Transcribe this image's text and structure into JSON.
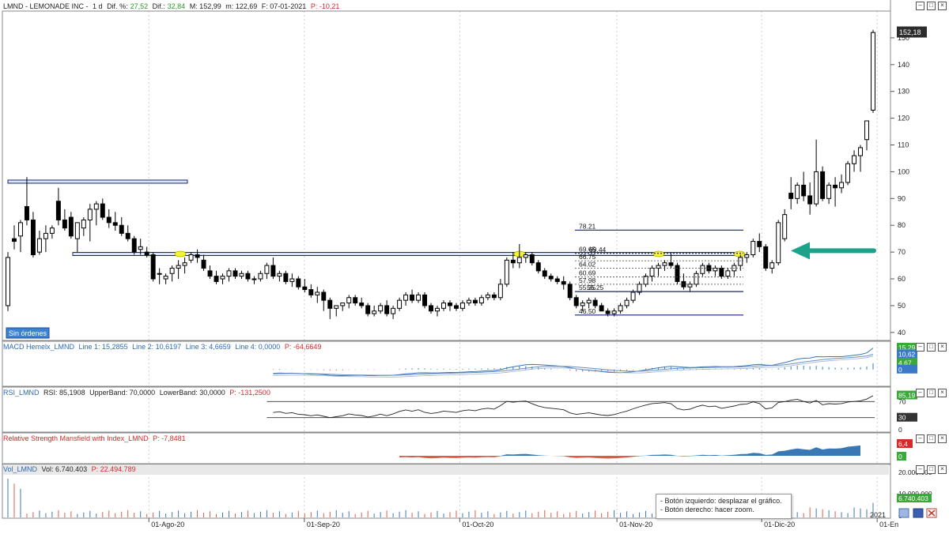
{
  "main_header": {
    "symbol": "LMND - LEMONADE INC -",
    "period": "1 d",
    "dif_pct_label": "Dif. %:",
    "dif_pct_value": "27,52",
    "dif_label": "Dif.:",
    "dif_value": "32,84",
    "max": "M: 152,99",
    "min": "m: 122,69",
    "date": "F: 07-01-2021",
    "p_value": "P: -10,21"
  },
  "sin_ordenes": "Sin órdenes",
  "price_tag": "152,18",
  "price_axis_ticks": [
    "150",
    "140",
    "130",
    "120",
    "110",
    "100",
    "90",
    "80",
    "70",
    "60",
    "50",
    "40"
  ],
  "fib_levels": [
    {
      "label": "78.21",
      "price": 78.21
    },
    {
      "label": "69.65",
      "price": 69.65
    },
    {
      "label": "69.44",
      "price": 69.44
    },
    {
      "label": "66.75",
      "price": 66.75
    },
    {
      "label": "64.02",
      "price": 64.02
    },
    {
      "label": "60.69",
      "price": 60.69
    },
    {
      "label": "57.98",
      "price": 57.98
    },
    {
      "label": "55.25",
      "price": 55.25
    },
    {
      "label": "55.35",
      "price": 55.35
    },
    {
      "label": "46.50",
      "price": 46.5
    }
  ],
  "date_labels": [
    "01-Ago-20",
    "01-Sep-20",
    "01-Oct-20",
    "01-Nov-20",
    "01-Dic-20",
    "01-En"
  ],
  "year_label": "2021",
  "macd": {
    "name": "MACD Hemelx_LMND",
    "l1": "Line 1: 15,2855",
    "l2": "Line 2: 10,6197",
    "l3": "Line 3: 4,6659",
    "l4": "Line 4: 0,0000",
    "p": "P: -64,6649",
    "tags": [
      "15,29",
      "10,62",
      "4,67",
      "0"
    ]
  },
  "rsi": {
    "name": "RSI_LMND",
    "value": "RSI: 85,1908",
    "upper": "UpperBand: 70,0000",
    "lower": "LowerBand: 30,0000",
    "p": "P: -131,2500",
    "tags": [
      "85,19",
      "70",
      "30",
      "0"
    ]
  },
  "rsm": {
    "name": "Relative Strength Mansfield with Index_LMND",
    "p": "P: -7,8481",
    "tags": [
      "6,4",
      "0"
    ]
  },
  "vol": {
    "name": "Vol_LMND",
    "value": "Vol: 6.740.403",
    "p": "P: 22.494.789",
    "tags": [
      "20.000.000",
      "10.000.000",
      "6.740.403",
      "0"
    ]
  },
  "tooltip": {
    "line1": "- Botón izquierdo: desplazar el gráfico.",
    "line2": "- Botón derecho: hacer zoom."
  },
  "colors": {
    "up": "#ffffff",
    "down": "#000000",
    "level_line": "#1a237e",
    "arrow": "#1aa28a",
    "macd_blue": "#3a78b5",
    "macd_red": "#e05a4a",
    "tag_green": "#3aa83a",
    "tag_blue": "#3a78c8",
    "tag_red": "#d42a2a"
  },
  "chart_data": {
    "type": "candlestick",
    "price_range": [
      37,
      160
    ],
    "candles": [
      [
        50,
        70,
        48,
        68
      ],
      [
        75,
        80,
        71,
        74
      ],
      [
        76,
        82,
        70,
        81
      ],
      [
        87,
        98,
        80,
        82
      ],
      [
        82,
        85,
        68,
        69
      ],
      [
        70,
        78,
        69,
        75
      ],
      [
        75,
        80,
        70,
        77
      ],
      [
        77,
        80,
        75,
        79
      ],
      [
        89,
        94,
        80,
        82
      ],
      [
        82,
        86,
        78,
        79
      ],
      [
        83,
        85,
        75,
        76
      ],
      [
        75,
        80,
        70,
        81
      ],
      [
        79,
        83,
        76,
        82
      ],
      [
        82,
        88,
        74,
        86
      ],
      [
        86,
        89,
        80,
        88
      ],
      [
        88,
        90,
        82,
        83
      ],
      [
        83,
        86,
        79,
        81
      ],
      [
        81,
        85,
        78,
        80
      ],
      [
        80,
        83,
        76,
        77
      ],
      [
        77,
        80,
        74,
        75
      ],
      [
        75,
        76,
        69,
        70
      ],
      [
        71,
        75,
        69,
        72
      ],
      [
        70,
        72,
        68,
        69
      ],
      [
        69,
        70,
        59,
        60
      ],
      [
        62,
        64,
        58,
        62
      ],
      [
        60,
        62,
        58,
        61
      ],
      [
        62,
        65,
        59,
        64
      ],
      [
        64,
        67,
        60,
        65
      ],
      [
        65,
        68,
        62,
        66
      ],
      [
        67,
        70,
        66,
        69
      ],
      [
        69,
        71,
        66,
        68
      ],
      [
        67,
        69,
        63,
        64
      ],
      [
        63,
        65,
        60,
        61
      ],
      [
        61,
        63,
        58,
        59
      ],
      [
        60,
        62,
        58,
        61
      ],
      [
        61,
        64,
        59,
        63
      ],
      [
        63,
        64,
        60,
        61
      ],
      [
        61,
        63,
        60,
        62
      ],
      [
        62,
        63,
        59,
        60
      ],
      [
        60,
        61,
        58,
        60
      ],
      [
        60,
        63,
        59,
        62
      ],
      [
        62,
        66,
        60,
        65
      ],
      [
        65,
        68,
        60,
        61
      ],
      [
        61,
        63,
        59,
        62
      ],
      [
        62,
        63,
        58,
        59
      ],
      [
        59,
        62,
        57,
        60
      ],
      [
        60,
        61,
        56,
        57
      ],
      [
        57,
        60,
        55,
        56
      ],
      [
        56,
        58,
        53,
        54
      ],
      [
        54,
        57,
        51,
        55
      ],
      [
        55,
        56,
        48,
        52
      ],
      [
        52,
        53,
        45,
        49
      ],
      [
        49,
        50,
        46,
        50
      ],
      [
        50,
        51,
        48,
        51
      ],
      [
        51,
        54,
        49,
        53
      ],
      [
        53,
        54,
        50,
        51
      ],
      [
        51,
        53,
        49,
        50
      ],
      [
        50,
        51,
        46,
        47
      ],
      [
        47,
        50,
        46,
        48
      ],
      [
        48,
        51,
        47,
        50
      ],
      [
        50,
        52,
        46,
        47
      ],
      [
        47,
        50,
        45,
        49
      ],
      [
        49,
        53,
        48,
        52
      ],
      [
        52,
        55,
        50,
        54
      ],
      [
        54,
        56,
        51,
        52
      ],
      [
        52,
        55,
        51,
        54
      ],
      [
        54,
        55,
        49,
        50
      ],
      [
        50,
        51,
        47,
        48
      ],
      [
        48,
        50,
        46,
        49
      ],
      [
        49,
        52,
        48,
        51
      ],
      [
        51,
        52,
        48,
        50
      ],
      [
        50,
        51,
        48,
        49
      ],
      [
        49,
        52,
        48,
        51
      ],
      [
        51,
        53,
        50,
        52
      ],
      [
        52,
        53,
        50,
        51
      ],
      [
        51,
        54,
        50,
        53
      ],
      [
        53,
        55,
        52,
        54
      ],
      [
        54,
        55,
        52,
        53
      ],
      [
        53,
        60,
        52,
        58
      ],
      [
        58,
        68,
        57,
        67
      ],
      [
        67,
        70,
        64,
        66
      ],
      [
        66,
        73,
        64,
        68
      ],
      [
        68,
        70,
        66,
        69
      ],
      [
        69,
        70,
        65,
        66
      ],
      [
        66,
        67,
        62,
        63
      ],
      [
        63,
        64,
        60,
        61
      ],
      [
        61,
        62,
        59,
        60
      ],
      [
        60,
        61,
        58,
        59
      ],
      [
        59,
        61,
        56,
        58
      ],
      [
        58,
        59,
        52,
        53
      ],
      [
        53,
        54,
        49,
        50
      ],
      [
        50,
        52,
        48,
        51
      ],
      [
        51,
        53,
        49,
        52
      ],
      [
        52,
        53,
        49,
        50
      ],
      [
        50,
        51,
        48,
        48
      ],
      [
        48,
        49,
        46,
        47
      ],
      [
        47,
        49,
        46,
        48
      ],
      [
        48,
        51,
        47,
        50
      ],
      [
        50,
        53,
        49,
        52
      ],
      [
        52,
        56,
        51,
        55
      ],
      [
        55,
        59,
        54,
        58
      ],
      [
        58,
        62,
        57,
        61
      ],
      [
        61,
        65,
        59,
        64
      ],
      [
        64,
        66,
        61,
        65
      ],
      [
        65,
        67,
        63,
        66
      ],
      [
        66,
        70,
        64,
        65
      ],
      [
        65,
        66,
        58,
        59
      ],
      [
        59,
        62,
        56,
        57
      ],
      [
        57,
        59,
        55,
        58
      ],
      [
        58,
        63,
        57,
        62
      ],
      [
        62,
        66,
        61,
        65
      ],
      [
        65,
        66,
        62,
        63
      ],
      [
        63,
        65,
        61,
        64
      ],
      [
        64,
        65,
        60,
        61
      ],
      [
        61,
        64,
        60,
        63
      ],
      [
        63,
        66,
        61,
        65
      ],
      [
        65,
        69,
        63,
        68
      ],
      [
        68,
        70,
        66,
        69
      ],
      [
        69,
        75,
        68,
        74
      ],
      [
        74,
        77,
        70,
        72
      ],
      [
        72,
        73,
        63,
        64
      ],
      [
        64,
        67,
        62,
        66
      ],
      [
        66,
        82,
        65,
        81
      ],
      [
        75,
        86,
        74,
        84
      ],
      [
        92,
        98,
        86,
        90
      ],
      [
        90,
        96,
        88,
        95
      ],
      [
        95,
        100,
        89,
        91
      ],
      [
        91,
        96,
        84,
        88
      ],
      [
        88,
        112,
        87,
        100
      ],
      [
        100,
        102,
        89,
        90
      ],
      [
        90,
        96,
        88,
        95
      ],
      [
        95,
        98,
        87,
        94
      ],
      [
        94,
        99,
        92,
        96
      ],
      [
        96,
        104,
        95,
        103
      ],
      [
        103,
        108,
        100,
        106
      ],
      [
        106,
        110,
        100,
        109
      ],
      [
        112,
        118,
        108,
        119
      ],
      [
        123,
        153,
        122,
        152
      ]
    ],
    "levels": [
      96.3,
      69.3
    ],
    "macd": {
      "line1": 15.2855,
      "line2": 10.6197,
      "line3": 4.6659,
      "line4": 0
    },
    "rsi": {
      "value": 85.1908,
      "upper": 70,
      "lower": 30
    },
    "rsm_value": 6.4,
    "volume_last": 6740403
  }
}
